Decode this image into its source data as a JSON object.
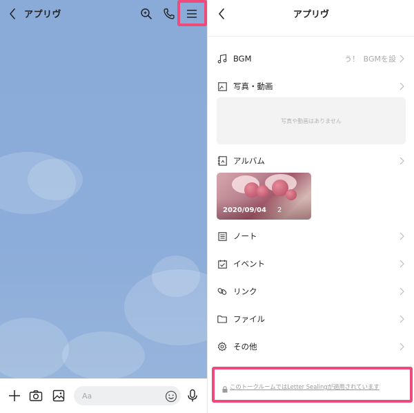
{
  "chat": {
    "title": "アプリヴ",
    "input_placeholder": "Aa"
  },
  "menu": {
    "title": "アプリヴ",
    "bgm": {
      "label": "BGM",
      "status": "う！",
      "value": "BGMを設"
    },
    "photos": {
      "label": "写真・動画",
      "empty_text": "写真や動画はありません"
    },
    "album": {
      "label": "アルバム",
      "date": "2020/09/04",
      "count": "2"
    },
    "note": {
      "label": "ノート"
    },
    "event": {
      "label": "イベント"
    },
    "link": {
      "label": "リンク"
    },
    "file": {
      "label": "ファイル"
    },
    "other": {
      "label": "その他"
    },
    "footer": "このトークルームではLetter Sealingが適用されています"
  },
  "colors": {
    "chat_bg": "#8aabd8",
    "highlight": "#ee4a7c",
    "text": "#222222",
    "muted": "#aaaaaa"
  },
  "icons": [
    "back-icon",
    "search-icon",
    "phone-icon",
    "menu-icon",
    "plus-icon",
    "camera-icon",
    "image-icon",
    "emoji-icon",
    "mic-icon",
    "music-icon",
    "photo-icon",
    "album-icon",
    "note-icon",
    "calendar-icon",
    "link-icon",
    "folder-icon",
    "gear-icon",
    "chevron-right-icon",
    "lock-icon"
  ]
}
